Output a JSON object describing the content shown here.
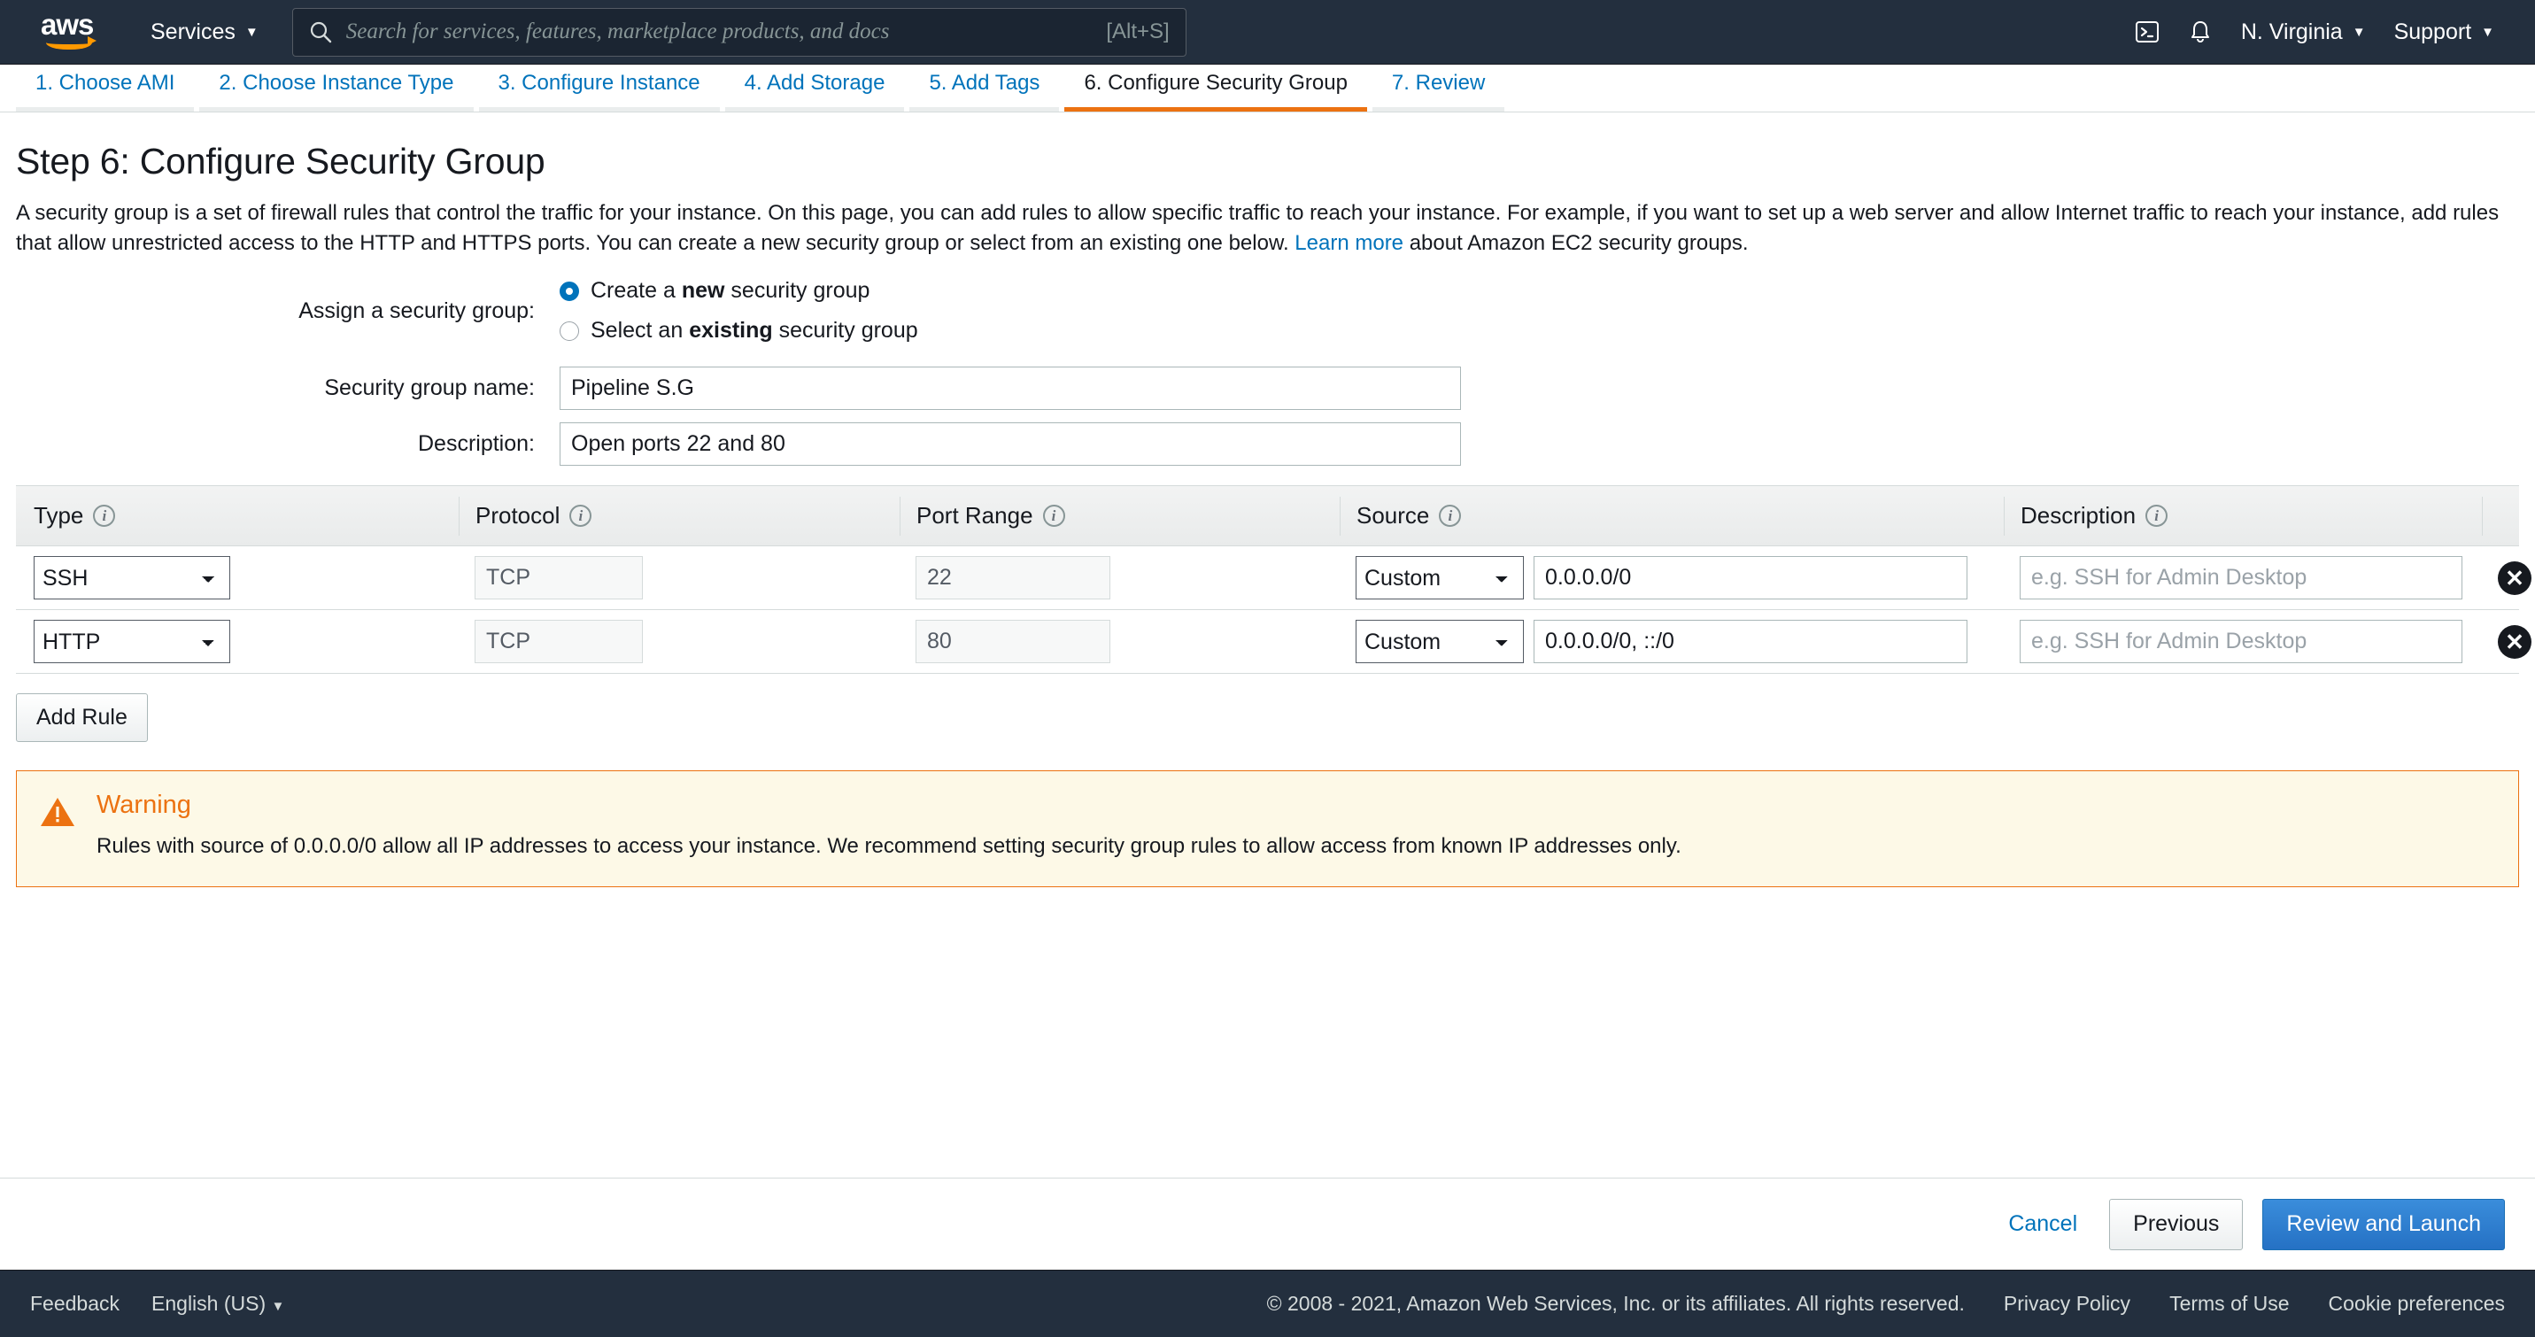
{
  "topnav": {
    "logo_text": "aws",
    "services_label": "Services",
    "search_placeholder": "Search for services, features, marketplace products, and docs",
    "search_shortcut": "[Alt+S]",
    "cloudshell_icon": "cloudshell-icon",
    "notifications_icon": "bell-icon",
    "region_label": "N. Virginia",
    "support_label": "Support",
    "caret": "▼"
  },
  "wizard": {
    "steps": [
      {
        "label": "1. Choose AMI",
        "active": false
      },
      {
        "label": "2. Choose Instance Type",
        "active": false
      },
      {
        "label": "3. Configure Instance",
        "active": false
      },
      {
        "label": "4. Add Storage",
        "active": false
      },
      {
        "label": "5. Add Tags",
        "active": false
      },
      {
        "label": "6. Configure Security Group",
        "active": true
      },
      {
        "label": "7. Review",
        "active": false
      }
    ],
    "active_step": 6,
    "active_color": "#ec7211",
    "link_color": "#0073bb"
  },
  "main": {
    "title": "Step 6: Configure Security Group",
    "intro_part1": "A security group is a set of firewall rules that control the traffic for your instance. On this page, you can add rules to allow specific traffic to reach your instance. For example, if you want to set up a web server and allow Internet traffic to reach your instance, add rules that allow unrestricted access to the HTTP and HTTPS ports. You can create a new security group or select from an existing one below. ",
    "intro_link": "Learn more",
    "intro_part2": " about Amazon EC2 security groups.",
    "assign_label": "Assign a security group:",
    "radio_new_prefix": "Create a ",
    "radio_new_bold": "new",
    "radio_new_suffix": " security group",
    "radio_existing_prefix": "Select an ",
    "radio_existing_bold": "existing",
    "radio_existing_suffix": " security group",
    "selected_option": "new",
    "sg_name_label": "Security group name:",
    "sg_name_value": "Pipeline S.G",
    "description_label": "Description:",
    "description_value": "Open ports 22 and 80"
  },
  "rules_table": {
    "headers": [
      {
        "label": "Type",
        "info": "info-icon"
      },
      {
        "label": "Protocol",
        "info": "info-icon"
      },
      {
        "label": "Port Range",
        "info": "info-icon"
      },
      {
        "label": "Source",
        "info": "info-icon"
      },
      {
        "label": "Description",
        "info": "info-icon"
      }
    ],
    "desc_placeholder": "e.g. SSH for Admin Desktop",
    "delete_icon": "delete-circle-icon",
    "rows": [
      {
        "type": "SSH",
        "protocol": "TCP",
        "port": "22",
        "source_type": "Custom",
        "source_value": "0.0.0.0/0",
        "description": ""
      },
      {
        "type": "HTTP",
        "protocol": "TCP",
        "port": "80",
        "source_type": "Custom",
        "source_value": "0.0.0.0/0, ::/0",
        "description": ""
      }
    ],
    "add_rule_label": "Add Rule"
  },
  "warning": {
    "icon": "warning-triangle-icon",
    "title": "Warning",
    "text": "Rules with source of 0.0.0.0/0 allow all IP addresses to access your instance. We recommend setting security group rules to allow access from known IP addresses only.",
    "border_color": "#ec7211",
    "background_color": "#fdf9e7"
  },
  "actions": {
    "cancel_label": "Cancel",
    "previous_label": "Previous",
    "review_label": "Review and Launch",
    "primary_color": "#2571c4"
  },
  "footer": {
    "feedback_label": "Feedback",
    "language_label": "English (US)",
    "caret": "▼",
    "copyright": "© 2008 - 2021, Amazon Web Services, Inc. or its affiliates. All rights reserved.",
    "privacy_label": "Privacy Policy",
    "terms_label": "Terms of Use",
    "cookie_label": "Cookie preferences"
  }
}
